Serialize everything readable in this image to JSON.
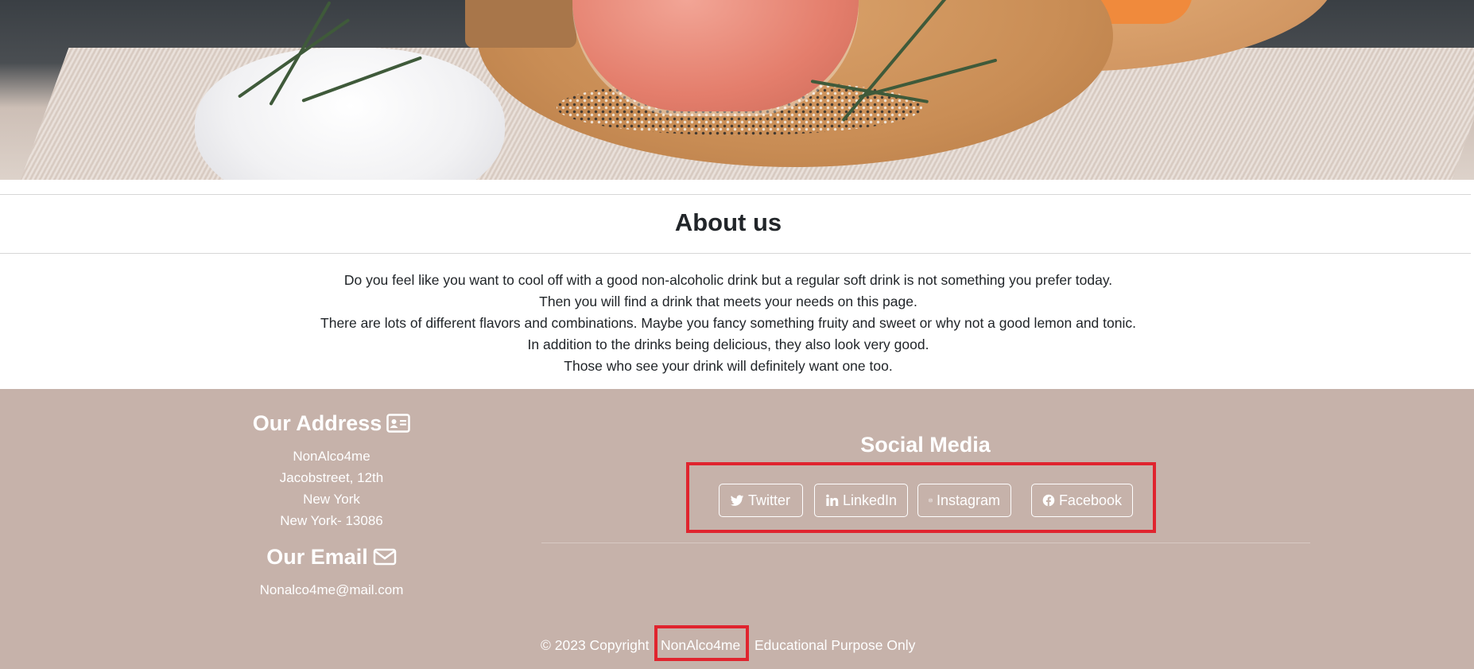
{
  "hero": {
    "image_icon": "cocktail-photo"
  },
  "about": {
    "title": "About us",
    "lines": [
      "Do you feel like you want to cool off with a good non-alcoholic drink but a regular soft drink is not something you prefer today.",
      "Then you will find a drink that meets your needs on this page.",
      "There are lots of different flavors and combinations. Maybe you fancy something fruity and sweet or why not a good lemon and tonic.",
      "In addition to the drinks being delicious, they also look very good.",
      "Those who see your drink will definitely want one too."
    ]
  },
  "footer": {
    "address_title": "Our Address",
    "address_icon": "address-card-icon",
    "address_lines": [
      "NonAlco4me",
      "Jacobstreet, 12th",
      "New York",
      "New York- 13086"
    ],
    "email_title": "Our Email",
    "email_icon": "envelope-icon",
    "email": "Nonalco4me@mail.com",
    "social_title": "Social Media",
    "social": [
      {
        "label": "Twitter",
        "icon": "twitter-icon"
      },
      {
        "label": "LinkedIn",
        "icon": "linkedin-icon"
      },
      {
        "label": "Instagram",
        "icon": "instagram-icon"
      },
      {
        "label": "Facebook",
        "icon": "facebook-icon"
      }
    ],
    "copyright_prefix": "© 2023 Copyright",
    "brand": "NonAlco4me",
    "copyright_suffix": "Educational Purpose Only",
    "colors": {
      "footer_bg": "#c6b2aa",
      "highlight": "#e0242e",
      "text": "#ffffff"
    }
  }
}
